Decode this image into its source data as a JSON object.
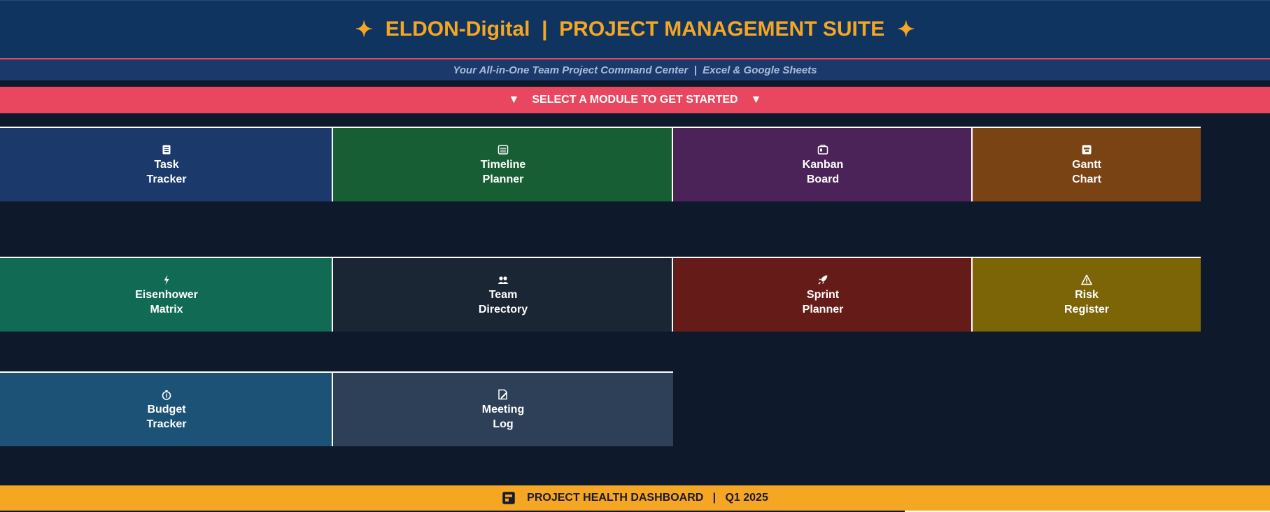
{
  "header": {
    "star_left": "✦",
    "title": "ELDON-Digital  |  PROJECT MANAGEMENT SUITE",
    "star_right": "✦"
  },
  "subtitle": "Your All-in-One Team Project Command Center  |  Excel & Google Sheets",
  "select_bar": {
    "arrow_left": "▼",
    "label": "SELECT A MODULE TO GET STARTED",
    "arrow_right": "▼"
  },
  "modules": [
    {
      "line1": "Task",
      "line2": "Tracker",
      "icon": "clipboard-icon",
      "color": "#1b3a6b"
    },
    {
      "line1": "Timeline",
      "line2": "Planner",
      "icon": "calendar-icon",
      "color": "#185e35"
    },
    {
      "line1": "Kanban",
      "line2": "Board",
      "icon": "board-icon",
      "color": "#4b2358"
    },
    {
      "line1": "Gantt",
      "line2": "Chart",
      "icon": "chart-icon",
      "color": "#7a4313"
    },
    {
      "line1": "Eisenhower",
      "line2": "Matrix",
      "icon": "lightning-icon",
      "color": "#116a53"
    },
    {
      "line1": "Team",
      "line2": "Directory",
      "icon": "people-icon",
      "color": "#1b2635"
    },
    {
      "line1": "Sprint",
      "line2": "Planner",
      "icon": "rocket-icon",
      "color": "#651b17"
    },
    {
      "line1": "Risk",
      "line2": "Register",
      "icon": "warning-icon",
      "color": "#7b6507"
    },
    {
      "line1": "Budget",
      "line2": "Tracker",
      "icon": "moneybag-icon",
      "color": "#1c5276"
    },
    {
      "line1": "Meeting",
      "line2": "Log",
      "icon": "memo-icon",
      "color": "#2e4058"
    }
  ],
  "footer": {
    "icon": "dashboard-icon",
    "label": "PROJECT HEALTH DASHBOARD   |   Q1 2025"
  },
  "colors": {
    "background": "#0e1a2b",
    "header_bg": "#0f3460",
    "accent_gold": "#f5a623",
    "accent_red": "#e8475f"
  }
}
